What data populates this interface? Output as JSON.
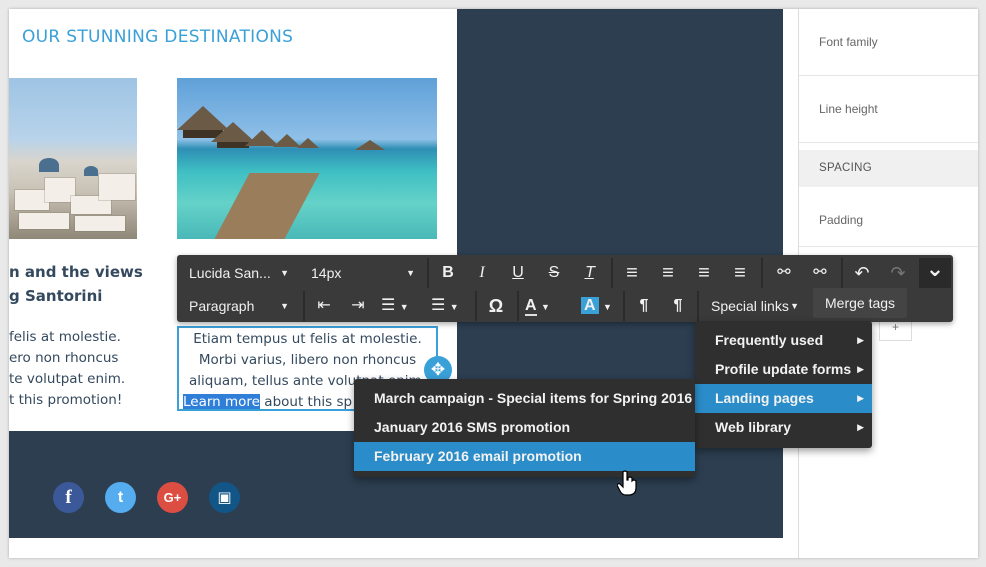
{
  "page": {
    "section_title": "OUR STUNNING DESTINATIONS"
  },
  "left_column": {
    "heading_line1": "n and the views",
    "heading_line2": "g Santorini",
    "text_lines": [
      "felis at molestie.",
      "ero non rhoncus",
      "te volutpat enim.",
      "t this promotion!"
    ]
  },
  "right_column": {
    "text_line1": "Etiam tempus ut felis at molestie.",
    "text_line2": "Morbi varius, libero non rhoncus",
    "text_line3": "aliquam, tellus ante volutpat enim.",
    "link_text": "Learn more",
    "text_line4_rest": " about this sp"
  },
  "toolbar": {
    "font_family": "Lucida San...",
    "font_size": "14px",
    "paragraph_style": "Paragraph",
    "special_links_label": "Special links",
    "merge_tags_label": "Merge tags",
    "icons": {
      "bold": "B",
      "italic": "I",
      "underline": "U",
      "strike": "S",
      "clear": "T̲",
      "align_left": "≡",
      "align_center": "≡",
      "align_right": "≡",
      "justify": "≡",
      "link": "⚯",
      "unlink": "⚯",
      "undo": "↶",
      "redo": "↷",
      "collapse": "⌄",
      "outdent": "⇤",
      "indent": "⇥",
      "numbered": "☰",
      "bulleted": "☰",
      "special_char": "Ω",
      "text_color": "A",
      "bg_color": "A",
      "ltr": "¶",
      "rtl": "¶"
    }
  },
  "special_links_menu": {
    "items": [
      {
        "label": "Frequently used"
      },
      {
        "label": "Profile update forms"
      },
      {
        "label": "Landing pages"
      },
      {
        "label": "Web library"
      }
    ],
    "active_index": 2
  },
  "landing_pages_submenu": {
    "items": [
      {
        "label": "March campaign - Special items for Spring 2016"
      },
      {
        "label": "January 2016 SMS promotion"
      },
      {
        "label": "February 2016 email promotion"
      }
    ],
    "hovered_index": 2
  },
  "props_panel": {
    "font_family_label": "Font family",
    "line_height_label": "Line height",
    "spacing_header": "SPACING",
    "padding_label": "Padding",
    "plus_label": "+"
  },
  "social": {
    "facebook": "f",
    "twitter": "t",
    "google_plus": "G+",
    "instagram": "▣"
  },
  "colors": {
    "accent": "#3aa0d8",
    "dark_bg": "#2c3e50",
    "menu_active": "#2a8cc8",
    "toolbar_bg": "#3a3a3a",
    "facebook": "#3b5998",
    "twitter": "#55acee",
    "google_plus": "#dc4e41",
    "instagram": "#125688"
  }
}
